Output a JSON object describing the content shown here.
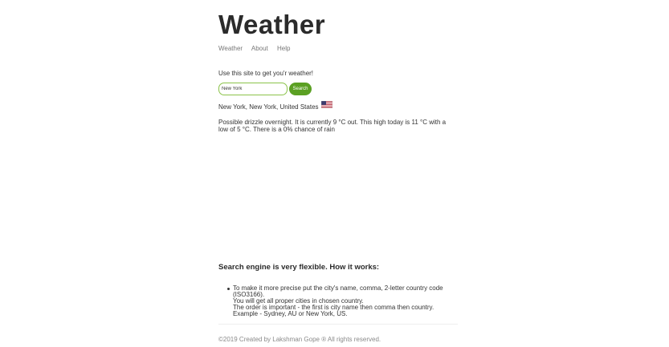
{
  "header": {
    "title": "Weather"
  },
  "nav": {
    "items": [
      {
        "label": "Weather"
      },
      {
        "label": "About"
      },
      {
        "label": "Help"
      }
    ]
  },
  "intro": {
    "text": "Use this site to get you'r weather!"
  },
  "search": {
    "value": "New York",
    "placeholder": "",
    "button_label": "Search"
  },
  "result": {
    "location": "New York, New York, United States",
    "flag_icon": "us-flag-icon",
    "forecast": "Possible drizzle overnight. It is currently 9 °C out. This high today is 11 °C with a low of 5 °C. There is a 0% chance of rain"
  },
  "how": {
    "title": "Search engine is very flexible. How it works:",
    "lines": [
      "To make it more precise put the city's name, comma, 2-letter country code (ISO3166).",
      "You will get all proper cities in chosen country.",
      "The order is important - the first is city name then comma then country. Example - Sydney, AU or New York, US."
    ]
  },
  "footer": {
    "text": "©2019 Created by Lakshman Gope ® All rights reserved."
  },
  "colors": {
    "accent": "#5ba023",
    "input_border": "#8bc34a",
    "text": "#333333",
    "muted": "#8a8a8a"
  }
}
